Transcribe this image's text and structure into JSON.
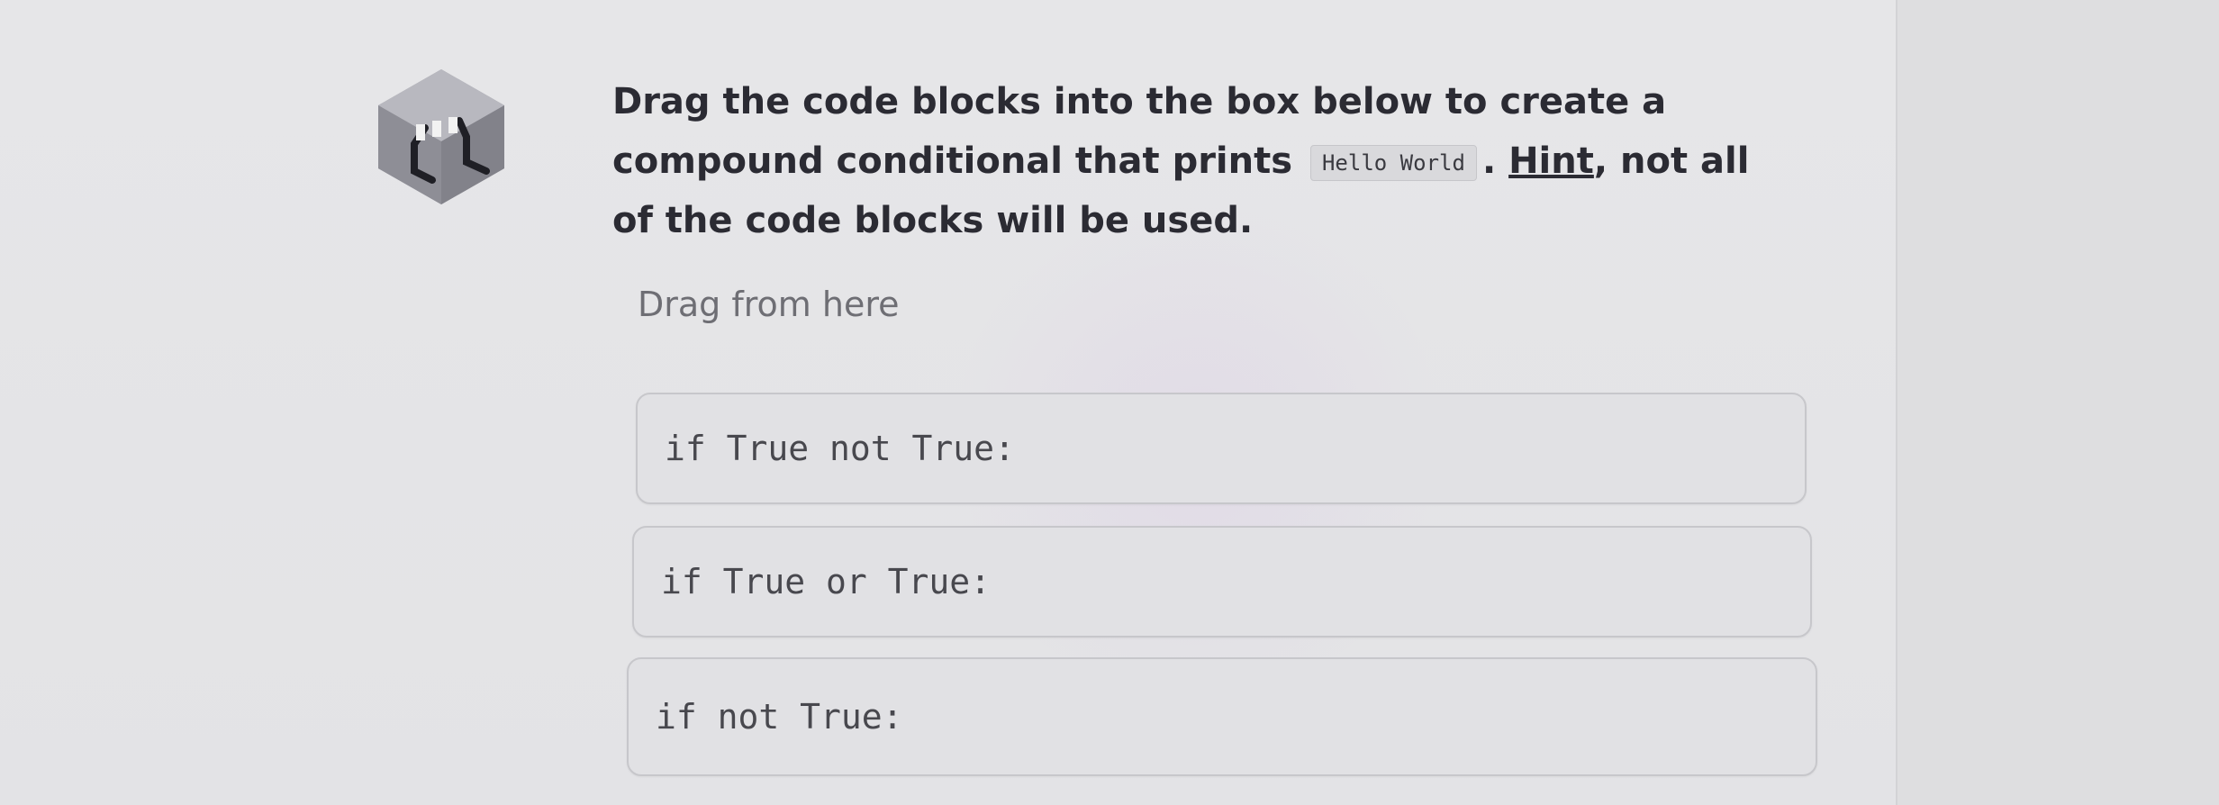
{
  "question": {
    "part1": "Drag the code blocks into the box below to create a compound conditional that prints",
    "code": "Hello World",
    "part2": ".",
    "hint": "Hint",
    "part3": ", not all of the code blocks will be used."
  },
  "drag_label": "Drag from here",
  "blocks": [
    {
      "text": "if True not True:"
    },
    {
      "text": "if True or True:"
    },
    {
      "text": "if not True:"
    }
  ],
  "icons": {
    "question": "code-bracket-cube-icon"
  }
}
